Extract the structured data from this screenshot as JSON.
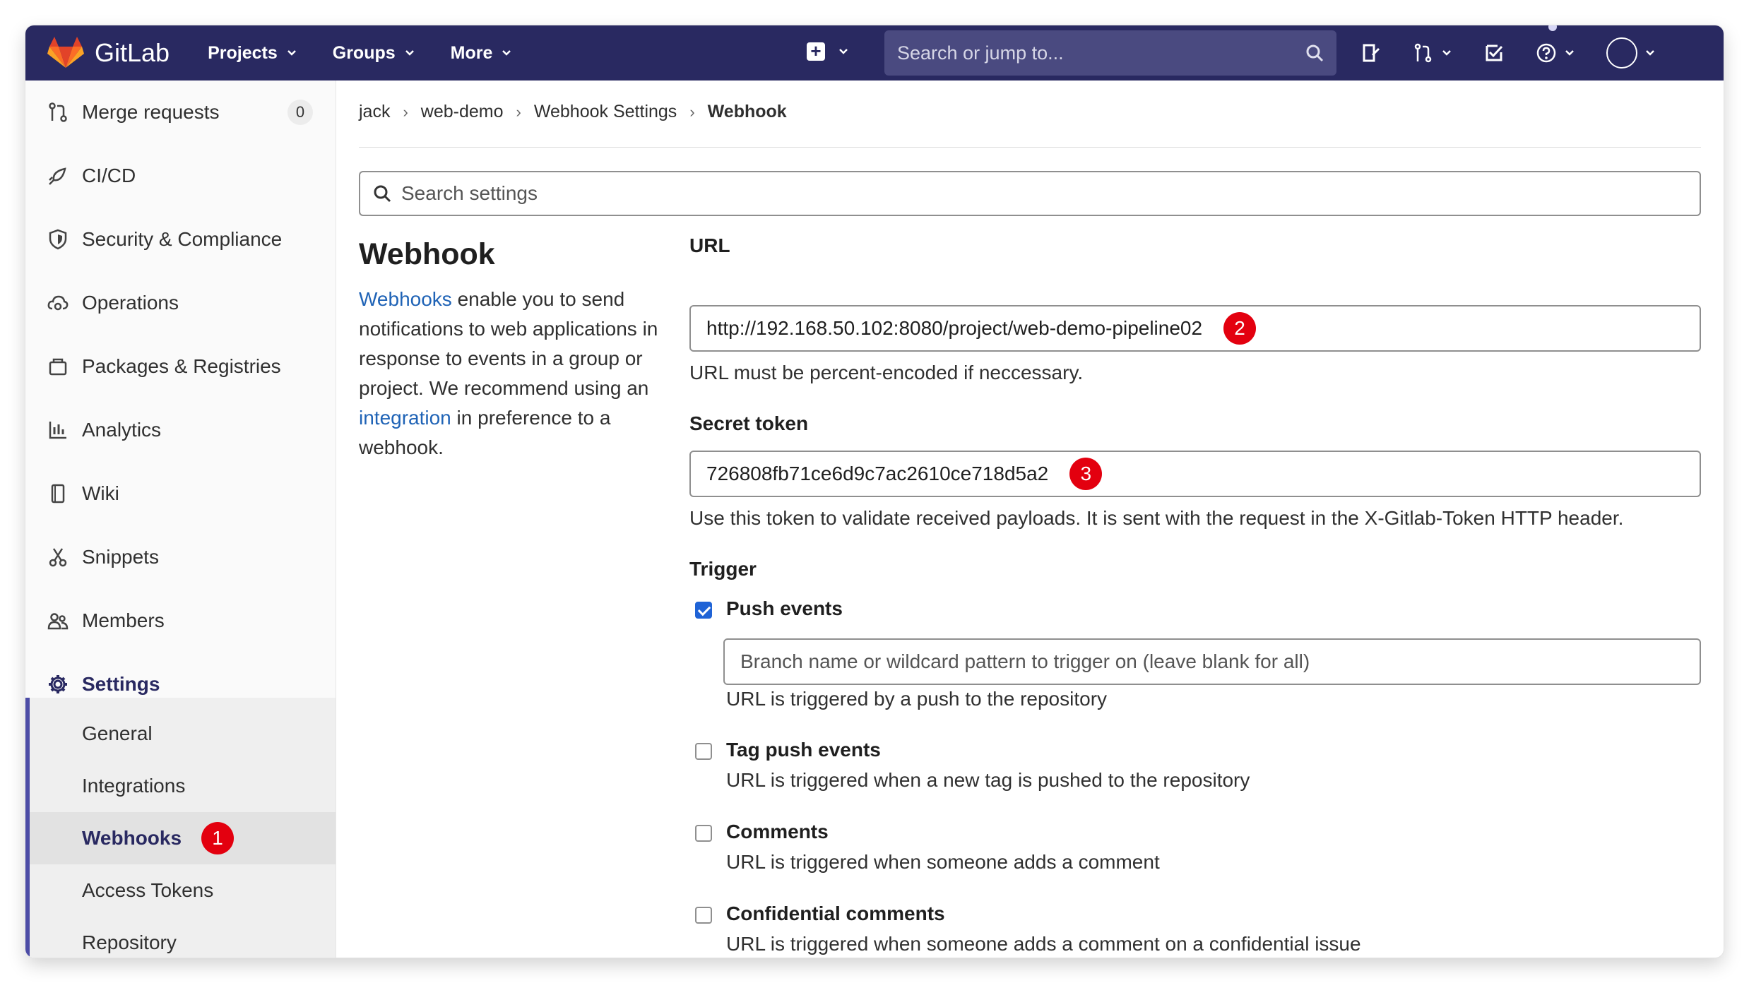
{
  "navbar": {
    "logo_text": "GitLab",
    "menu": [
      {
        "label": "Projects"
      },
      {
        "label": "Groups"
      },
      {
        "label": "More"
      }
    ],
    "search_placeholder": "Search or jump to...",
    "brand_color": "#292961"
  },
  "sidebar": {
    "items": [
      {
        "label": "Merge requests",
        "icon": "merge-request-icon",
        "count": "0"
      },
      {
        "label": "CI/CD",
        "icon": "rocket-icon"
      },
      {
        "label": "Security & Compliance",
        "icon": "shield-icon"
      },
      {
        "label": "Operations",
        "icon": "cloud-gear-icon"
      },
      {
        "label": "Packages & Registries",
        "icon": "package-icon"
      },
      {
        "label": "Analytics",
        "icon": "chart-icon"
      },
      {
        "label": "Wiki",
        "icon": "book-icon"
      },
      {
        "label": "Snippets",
        "icon": "scissors-icon"
      },
      {
        "label": "Members",
        "icon": "users-icon"
      },
      {
        "label": "Settings",
        "icon": "gear-icon"
      }
    ],
    "settings_sub": [
      {
        "label": "General"
      },
      {
        "label": "Integrations"
      },
      {
        "label": "Webhooks",
        "badge": "1"
      },
      {
        "label": "Access Tokens"
      },
      {
        "label": "Repository"
      }
    ]
  },
  "breadcrumb": [
    "jack",
    "web-demo",
    "Webhook Settings",
    "Webhook"
  ],
  "search_settings_placeholder": "Search settings",
  "intro": {
    "title": "Webhook",
    "link1": "Webhooks",
    "text1": " enable you to send notifications to web applications in response to events in a group or project. We recommend using an ",
    "link2": "integration",
    "text2": " in preference to a webhook."
  },
  "form": {
    "url_label": "URL",
    "url_value": "http://192.168.50.102:8080/project/web-demo-pipeline02",
    "url_badge": "2",
    "url_help": "URL must be percent-encoded if neccessary.",
    "token_label": "Secret token",
    "token_value": "726808fb71ce6d9c7ac2610ce718d5a2",
    "token_badge": "3",
    "token_help": "Use this token to validate received payloads. It is sent with the request in the X-Gitlab-Token HTTP header.",
    "trigger_label": "Trigger",
    "branch_placeholder": "Branch name or wildcard pattern to trigger on (leave blank for all)",
    "triggers": [
      {
        "title": "Push events",
        "help": "URL is triggered by a push to the repository",
        "checked": true
      },
      {
        "title": "Tag push events",
        "help": "URL is triggered when a new tag is pushed to the repository",
        "checked": false
      },
      {
        "title": "Comments",
        "help": "URL is triggered when someone adds a comment",
        "checked": false
      },
      {
        "title": "Confidential comments",
        "help": "URL is triggered when someone adds a comment on a confidential issue",
        "checked": false
      }
    ]
  }
}
